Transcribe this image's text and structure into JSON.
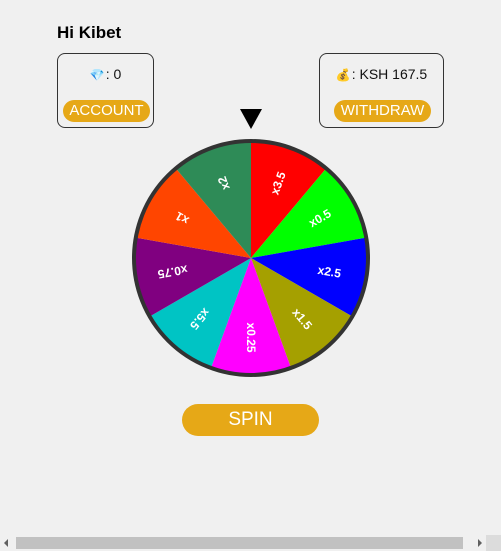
{
  "header": {
    "greeting": "Hi Kibet"
  },
  "account_card": {
    "icon": "gem-icon",
    "icon_glyph": "💎",
    "balance": ": 0",
    "button_label": "ACCOUNT"
  },
  "wallet_card": {
    "icon": "money-bag-icon",
    "icon_glyph": "💰",
    "balance": ": KSH 167.5",
    "button_label": "WITHDRAW"
  },
  "wheel": {
    "pointer_icon": "pointer-triangle-icon",
    "segments": [
      {
        "label": "x3.5",
        "color": "#ff0000"
      },
      {
        "label": "x0.5",
        "color": "#00ff00"
      },
      {
        "label": "x2.5",
        "color": "#0000ff"
      },
      {
        "label": "x1.5",
        "color": "#a5a000"
      },
      {
        "label": "x0.25",
        "color": "#ff00ff"
      },
      {
        "label": "x5.5",
        "color": "#00c4c4"
      },
      {
        "label": "x0.75",
        "color": "#800080"
      },
      {
        "label": "x1",
        "color": "#ff4500"
      },
      {
        "label": "x2",
        "color": "#2e8b57"
      }
    ],
    "rim_color": "#333333"
  },
  "spin_button": {
    "label": "SPIN"
  },
  "colors": {
    "accent": "#e6a817",
    "background": "#f0f0f0"
  }
}
